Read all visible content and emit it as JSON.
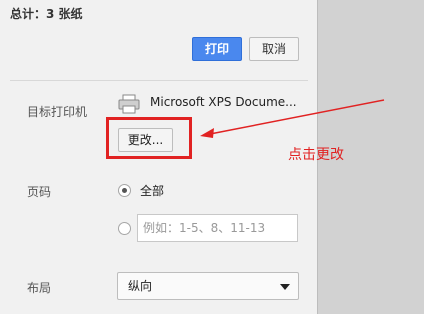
{
  "summary": {
    "total": "总计：3 张纸"
  },
  "actions": {
    "print_label": "打印",
    "cancel_label": "取消"
  },
  "destination": {
    "label": "目标打印机",
    "printer_name": "Microsoft XPS Docume...",
    "change_label": "更改...",
    "icon": "printer-icon"
  },
  "pages": {
    "label": "页码",
    "all_label": "全部",
    "selected": "全部",
    "custom_placeholder": "例如：1-5、8、11-13"
  },
  "layout": {
    "label": "布局",
    "value": "纵向"
  },
  "annotation": {
    "text": "点击更改",
    "color": "#e12222"
  },
  "colors": {
    "accent": "#4a88ee",
    "highlight": "#e12222"
  }
}
